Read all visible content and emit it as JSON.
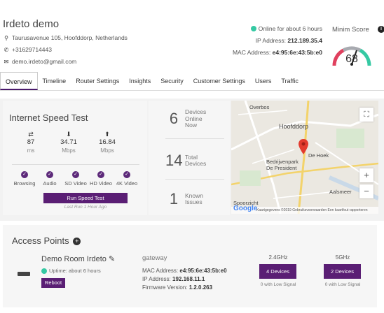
{
  "header": {
    "title": "Irdeto demo",
    "address": "Taurusavenue 105, Hoofddorp, Netherlands",
    "phone": "+31629714443",
    "email": "demo.irdeto@gmail.com",
    "online_status": "Online for about 6 hours",
    "ip_label": "IP Address:",
    "ip_value": "212.189.35.4",
    "mac_label": "MAC Address:",
    "mac_value": "e4:95:6e:43:5b:e0"
  },
  "score": {
    "title": "Minim Score",
    "value": "68",
    "info_icon": "i"
  },
  "tabs": [
    {
      "label": "Overview",
      "active": true
    },
    {
      "label": "Timeline"
    },
    {
      "label": "Router Settings"
    },
    {
      "label": "Insights"
    },
    {
      "label": "Security"
    },
    {
      "label": "Customer Settings"
    },
    {
      "label": "Users"
    },
    {
      "label": "Traffic"
    }
  ],
  "speed_test": {
    "title": "Internet Speed Test",
    "metrics": [
      {
        "icon": "ping-arrows-icon",
        "glyph": "⇄",
        "value": "87",
        "unit": "ms"
      },
      {
        "icon": "download-icon",
        "glyph": "⬇",
        "value": "34.71",
        "unit": "Mbps"
      },
      {
        "icon": "upload-icon",
        "glyph": "⬆",
        "value": "16.84",
        "unit": "Mbps"
      }
    ],
    "checks": [
      "Browsing",
      "Audio",
      "SD Video",
      "HD Video",
      "4K Video"
    ],
    "button": "Run Speed Test",
    "last_run": "Last Run 1 Hour Ago"
  },
  "device_stats": [
    {
      "number": "6",
      "label_lines": [
        "Devices",
        "Online",
        "Now"
      ]
    },
    {
      "number": "14",
      "label_lines": [
        "Total",
        "Devices"
      ]
    },
    {
      "number": "1",
      "label_lines": [
        "Known",
        "Issues"
      ]
    }
  ],
  "map": {
    "labels": [
      "Overbos",
      "Hoofddorp",
      "De Hoek",
      "Bedrijvenpark",
      "De President",
      "Aalsmeer",
      "Spoorzicht"
    ],
    "footer": "Kaartgegevens ©2019   Gebruiksvoorwaarden   Een kaartfout rapporteren",
    "google": "Google"
  },
  "access_points": {
    "title": "Access Points",
    "items": [
      {
        "name": "Demo Room Irdeto",
        "uptime": "Uptime: about 6 hours",
        "reboot": "Reboot",
        "role": "gateway",
        "mac_label": "MAC Address:",
        "mac_value": "e4:95:6e:43:5b:e0",
        "ip_label": "IP Address:",
        "ip_value": "192.168.11.1",
        "fw_label": "Firmware Version:",
        "fw_value": "1.2.0.263",
        "bands": [
          {
            "name": "2.4GHz",
            "devices": "4 Devices",
            "signal": "0 with Low Signal"
          },
          {
            "name": "5GHz",
            "devices": "2 Devices",
            "signal": "0 with Low Signal"
          }
        ]
      }
    ]
  },
  "colors": {
    "accent": "#5a1e74",
    "online": "#35c9a3"
  }
}
